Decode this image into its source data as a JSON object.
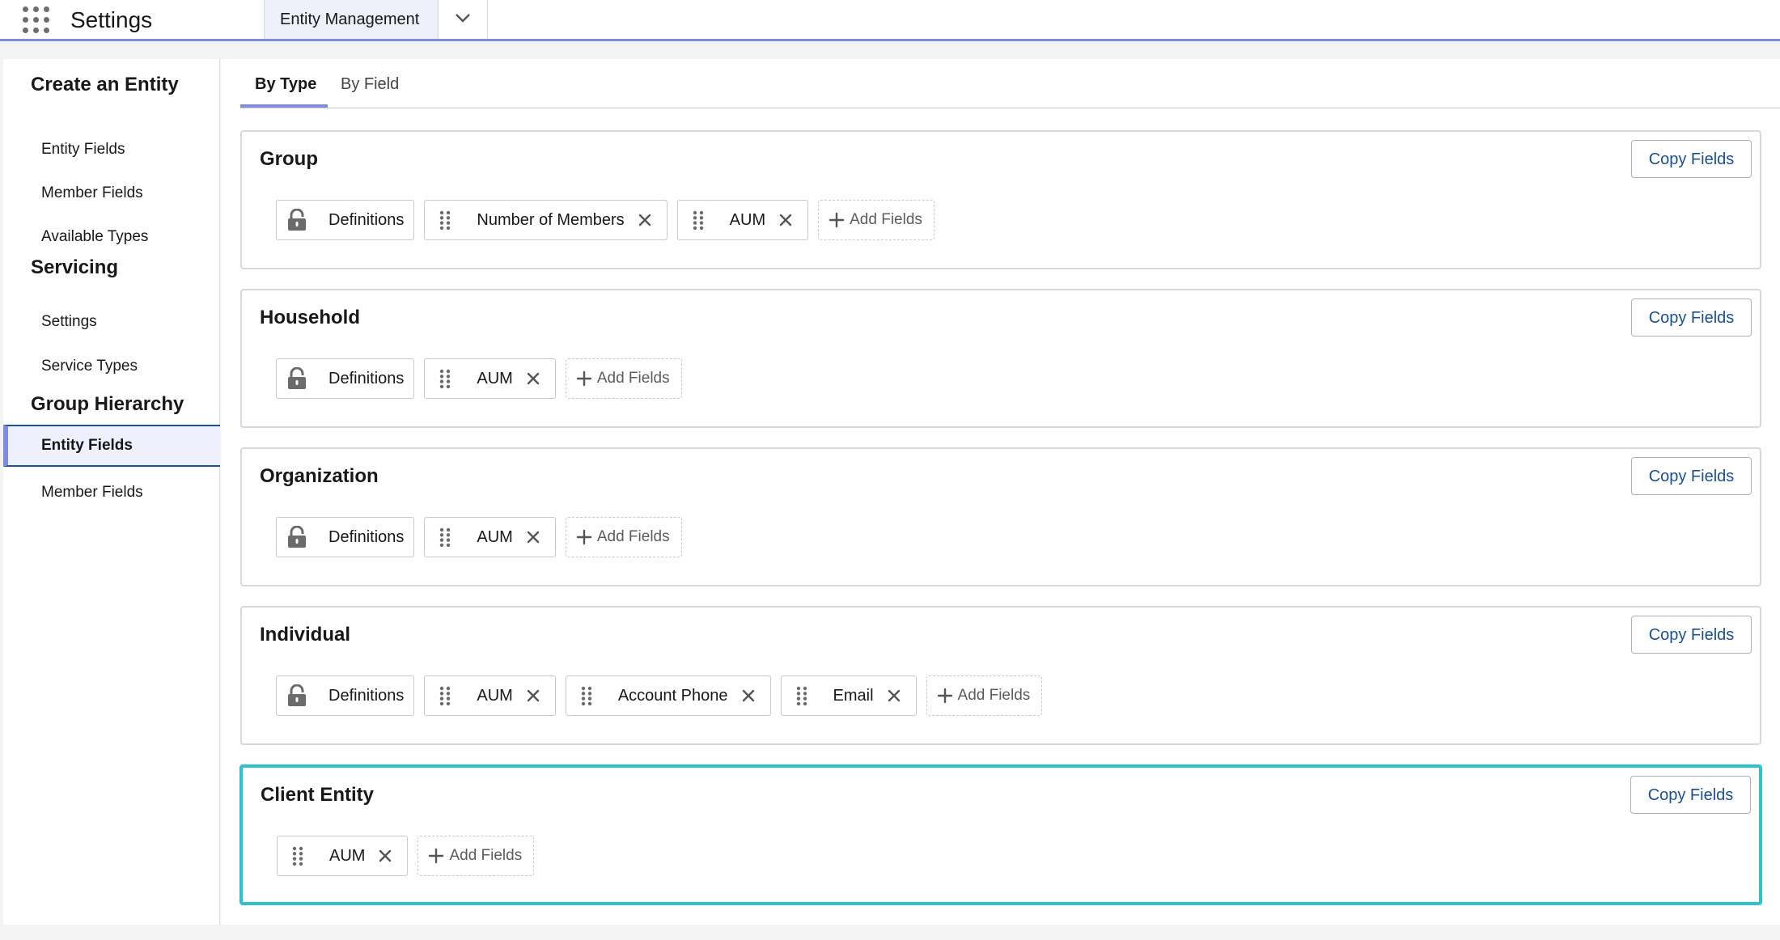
{
  "header": {
    "app_title": "Settings",
    "nav_tab": "Entity Management",
    "launcher_icon": "app-launcher-grid-icon",
    "accent": "#7f8de1"
  },
  "sidebar": {
    "sections": [
      {
        "heading": "Create an Entity",
        "items": [
          {
            "label": "Entity Fields",
            "active": false
          },
          {
            "label": "Member Fields",
            "active": false
          },
          {
            "label": "Available Types",
            "active": false
          }
        ]
      },
      {
        "heading": "Servicing",
        "items": [
          {
            "label": "Settings",
            "active": false
          },
          {
            "label": "Service Types",
            "active": false
          }
        ]
      },
      {
        "heading": "Group Hierarchy",
        "items": [
          {
            "label": "Entity Fields",
            "active": true
          },
          {
            "label": "Member Fields",
            "active": false
          }
        ]
      }
    ]
  },
  "main": {
    "tabs": [
      {
        "label": "By Type",
        "active": true
      },
      {
        "label": "By Field",
        "active": false
      }
    ],
    "copy_label": "Copy Fields",
    "add_label": "Add Fields",
    "cards": [
      {
        "title": "Group",
        "highlighted": false,
        "fields": [
          {
            "label": "Definitions",
            "locked": true
          },
          {
            "label": "Number of Members",
            "locked": false
          },
          {
            "label": "AUM",
            "locked": false
          }
        ]
      },
      {
        "title": "Household",
        "highlighted": false,
        "fields": [
          {
            "label": "Definitions",
            "locked": true
          },
          {
            "label": "AUM",
            "locked": false
          }
        ]
      },
      {
        "title": "Organization",
        "highlighted": false,
        "fields": [
          {
            "label": "Definitions",
            "locked": true
          },
          {
            "label": "AUM",
            "locked": false
          }
        ]
      },
      {
        "title": "Individual",
        "highlighted": false,
        "fields": [
          {
            "label": "Definitions",
            "locked": true
          },
          {
            "label": "AUM",
            "locked": false
          },
          {
            "label": "Account Phone",
            "locked": false
          },
          {
            "label": "Email",
            "locked": false
          }
        ]
      },
      {
        "title": "Client Entity",
        "highlighted": true,
        "fields": [
          {
            "label": "AUM",
            "locked": false
          }
        ]
      }
    ]
  },
  "colors": {
    "highlight_border": "#2ec0d3",
    "copy_text": "#1b4f94",
    "active_tab_underline": "#7f8de1"
  }
}
